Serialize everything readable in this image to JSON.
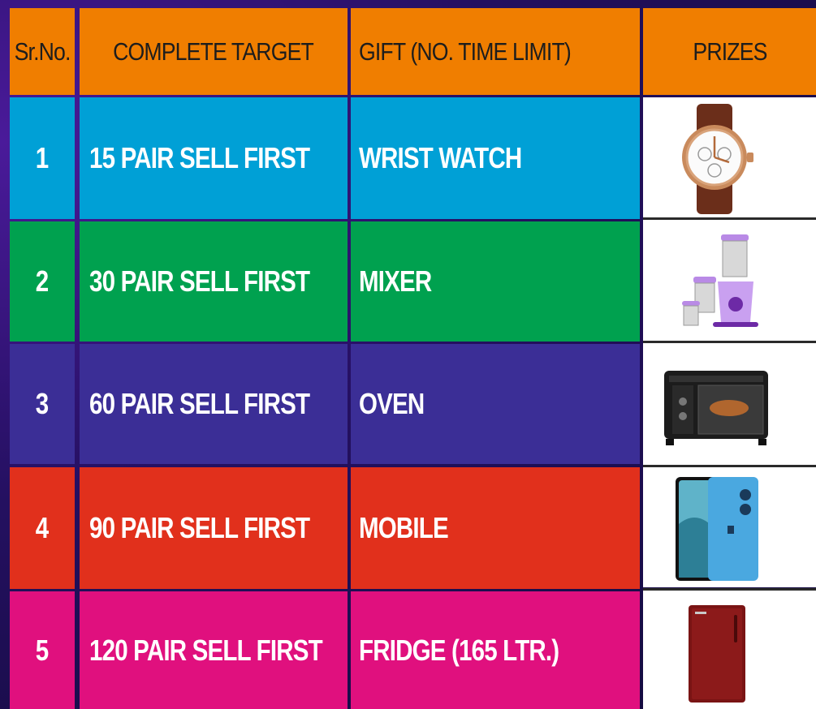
{
  "header": {
    "srno": "Sr.No.",
    "target": "COMPLETE TARGET",
    "gift": "GIFT (NO. TIME LIMIT)",
    "prizes": "PRIZES"
  },
  "rows": [
    {
      "no": "1",
      "target": "15 PAIR SELL FIRST",
      "gift": "WRIST WATCH",
      "color": "#00a0d6",
      "prize_icon": "wrist-watch-icon"
    },
    {
      "no": "2",
      "target": "30 PAIR SELL FIRST",
      "gift": "MIXER",
      "color": "#00a14f",
      "prize_icon": "mixer-grinder-icon"
    },
    {
      "no": "3",
      "target": "60 PAIR SELL FIRST",
      "gift": "OVEN",
      "color": "#3b2e96",
      "prize_icon": "oven-icon"
    },
    {
      "no": "4",
      "target": "90 PAIR SELL FIRST",
      "gift": "MOBILE",
      "color": "#e1301c",
      "prize_icon": "mobile-phone-icon"
    },
    {
      "no": "5",
      "target": "120 PAIR SELL FIRST",
      "gift": "FRIDGE (165 LTR.)",
      "color": "#e0107e",
      "prize_icon": "fridge-icon"
    }
  ]
}
